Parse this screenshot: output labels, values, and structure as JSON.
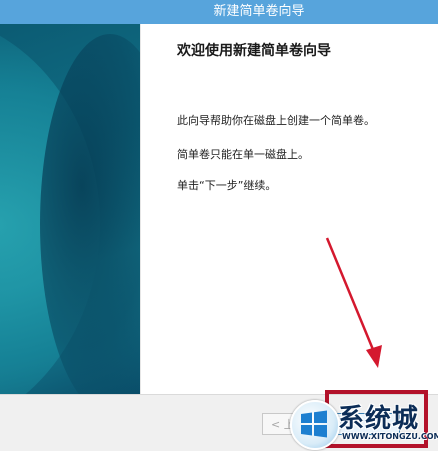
{
  "window": {
    "title": "新建简单卷向导"
  },
  "content": {
    "heading": "欢迎使用新建简单卷向导",
    "paragraphs": [
      "此向导帮助你在磁盘上创建一个简单卷。",
      "简单卷只能在单一磁盘上。",
      "单击“下一步”继续。"
    ]
  },
  "footer": {
    "back_label": "< 上",
    "next_label": ""
  },
  "watermark": {
    "brand": "系统城",
    "url": "WWW.XITONGZU.COM"
  },
  "colors": {
    "titlebar": "#57a4dc",
    "annotation_red": "#b3122a",
    "banner_teal": "#0f6e84"
  }
}
